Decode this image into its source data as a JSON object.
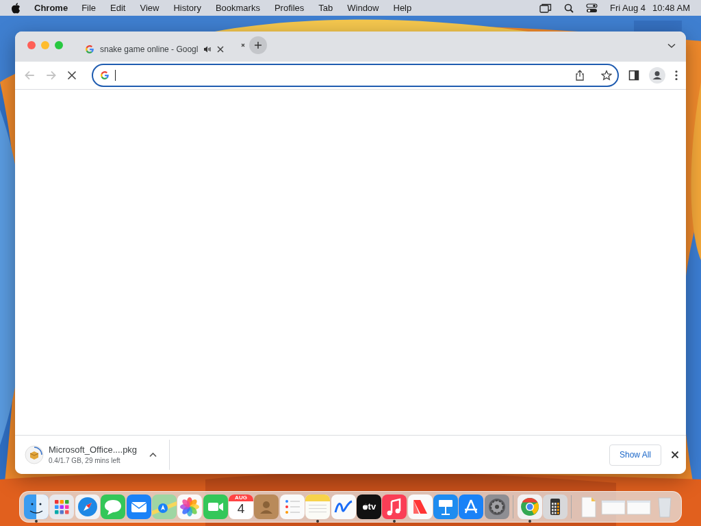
{
  "menu_bar": {
    "app": "Chrome",
    "menus": [
      "File",
      "Edit",
      "View",
      "History",
      "Bookmarks",
      "Profiles",
      "Tab",
      "Window",
      "Help"
    ],
    "date": "Fri Aug 4",
    "time": "10:48 AM"
  },
  "browser": {
    "tabs": [
      {
        "title": "snake game online - Googl",
        "audio": true,
        "selected": true
      }
    ],
    "back_disabled": true,
    "forward_disabled": true,
    "loading": true,
    "address_focused": true,
    "download": {
      "filename": "Microsoft_Office....pkg",
      "status": "0.4/1.7 GB, 29 mins left"
    },
    "show_all": "Show All"
  },
  "dock": {
    "items": [
      {
        "kind": "finder",
        "running": true
      },
      {
        "kind": "launchpad",
        "running": false
      },
      {
        "kind": "safari",
        "running": false
      },
      {
        "kind": "messages",
        "running": false
      },
      {
        "kind": "mail",
        "running": false
      },
      {
        "kind": "maps",
        "running": false
      },
      {
        "kind": "photos",
        "running": false
      },
      {
        "kind": "facetime",
        "running": false
      },
      {
        "kind": "calendar",
        "running": false,
        "month": "AUG",
        "day": "4"
      },
      {
        "kind": "contacts",
        "running": false
      },
      {
        "kind": "reminders",
        "running": false
      },
      {
        "kind": "notes",
        "running": true
      },
      {
        "kind": "freeform",
        "running": false
      },
      {
        "kind": "tv",
        "running": false,
        "label": "tv"
      },
      {
        "kind": "music",
        "running": true
      },
      {
        "kind": "news",
        "running": false
      },
      {
        "kind": "keynote",
        "running": false
      },
      {
        "kind": "appstore",
        "running": false
      },
      {
        "kind": "settings",
        "running": false
      },
      {
        "kind": "separator"
      },
      {
        "kind": "chrome",
        "running": true
      },
      {
        "kind": "calculator",
        "running": false
      },
      {
        "kind": "separator"
      },
      {
        "kind": "document",
        "running": false
      },
      {
        "kind": "window",
        "running": false
      },
      {
        "kind": "window",
        "running": false
      },
      {
        "kind": "trash",
        "running": false
      }
    ]
  }
}
